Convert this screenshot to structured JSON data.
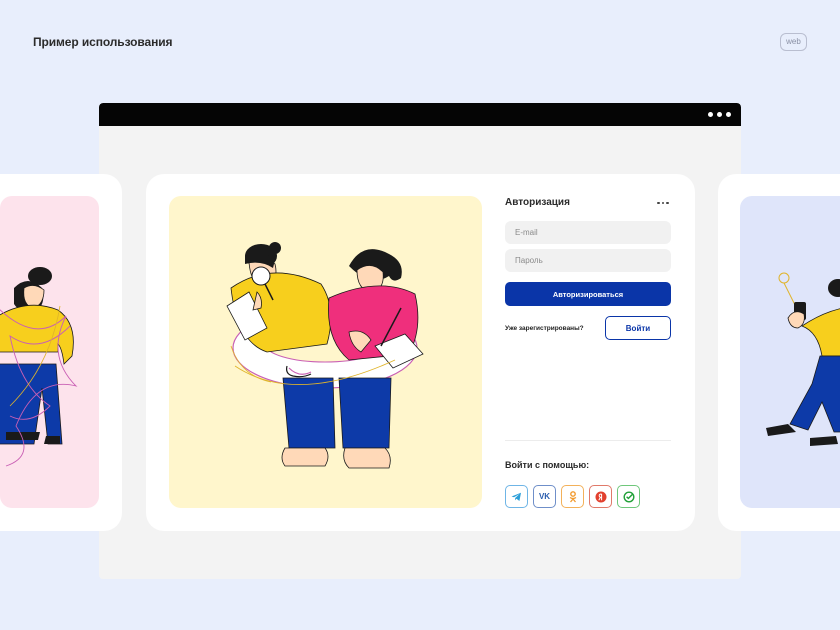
{
  "page": {
    "title": "Пример использования",
    "platform_tag": "web"
  },
  "auth": {
    "title": "Авторизация",
    "email_placeholder": "E-mail",
    "password_placeholder": "Пароль",
    "submit_label": "Авторизироваться",
    "already_registered": "Уже зарегистрированы?",
    "login_label": "Войти",
    "social_title": "Войти с помощью:",
    "social": [
      {
        "name": "telegram-icon",
        "color": "#2a9ed8"
      },
      {
        "name": "vk-icon",
        "label": "VK",
        "color": "#2a5dae"
      },
      {
        "name": "odnoklassniki-icon",
        "color": "#f29a2e"
      },
      {
        "name": "yandex-icon",
        "color": "#e2402e"
      },
      {
        "name": "sber-icon",
        "color": "#21a038"
      }
    ]
  },
  "colors": {
    "background": "#e8eefc",
    "primary": "#0a35a8",
    "illustration_main_bg": "#fff6cc",
    "illustration_left_bg": "#fde3ec",
    "illustration_right_bg": "#dfe5fa"
  }
}
